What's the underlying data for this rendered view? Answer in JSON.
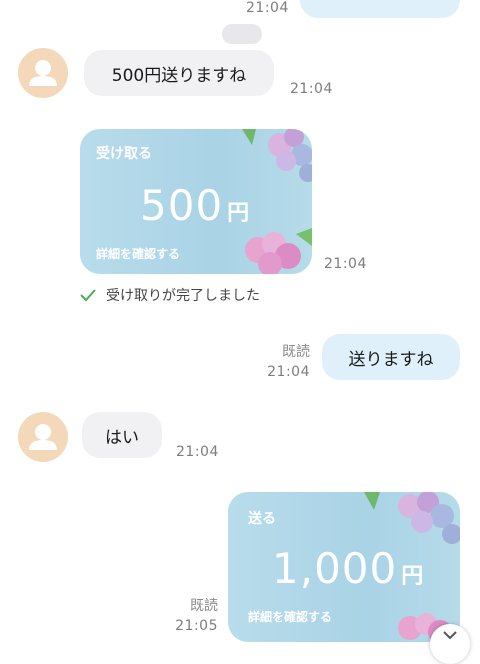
{
  "top": {
    "time": "21:04"
  },
  "messages": [
    {
      "text": "500円送りますね",
      "time": "21:04"
    },
    {
      "card": {
        "label": "受け取る",
        "amount": "500",
        "unit": "円",
        "detail": "詳細を確認する"
      },
      "time": "21:04"
    },
    {
      "status": "受け取りが完了しました"
    },
    {
      "text": "送りますね",
      "read": "既読",
      "time": "21:04"
    },
    {
      "text": "はい",
      "time": "21:04"
    },
    {
      "card": {
        "label": "送る",
        "amount": "1,000",
        "unit": "円",
        "detail": "詳細を確認する"
      },
      "read": "既読",
      "time": "21:05"
    }
  ],
  "colors": {
    "card_blue": "#a9d3e6",
    "bubble_in": "#f1f1f3",
    "bubble_out": "#dff0fb",
    "avatar": "#f3d8b9",
    "check": "#4caf50"
  },
  "icons": [
    "user-avatar-icon",
    "check-icon",
    "hydrangea-decoration",
    "scroll-down-icon"
  ]
}
